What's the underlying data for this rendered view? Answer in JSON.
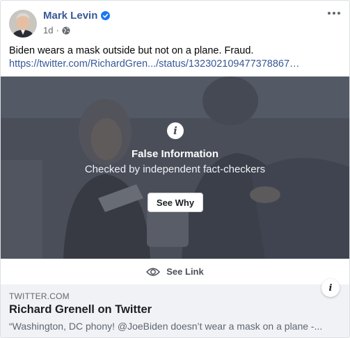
{
  "post": {
    "author": "Mark Levin",
    "time": "1d",
    "separator": "·",
    "text": "Biden wears a mask outside but not on a plane. Fraud.",
    "link": "https://twitter.com/RichardGren.../status/132302109477378867…"
  },
  "warning": {
    "title": "False Information",
    "subtitle": "Checked by independent fact-checkers",
    "button": "See Why",
    "icon": "info-icon"
  },
  "see_link": {
    "label": "See Link"
  },
  "preview": {
    "domain": "TWITTER.COM",
    "title": "Richard Grenell on Twitter",
    "description": "“Washington, DC phony! @JoeBiden doesn’t wear a mask on a plane -..."
  },
  "colors": {
    "author_blue": "#385898",
    "verified_blue": "#1877f2",
    "overlay_gray": "#59606c"
  }
}
